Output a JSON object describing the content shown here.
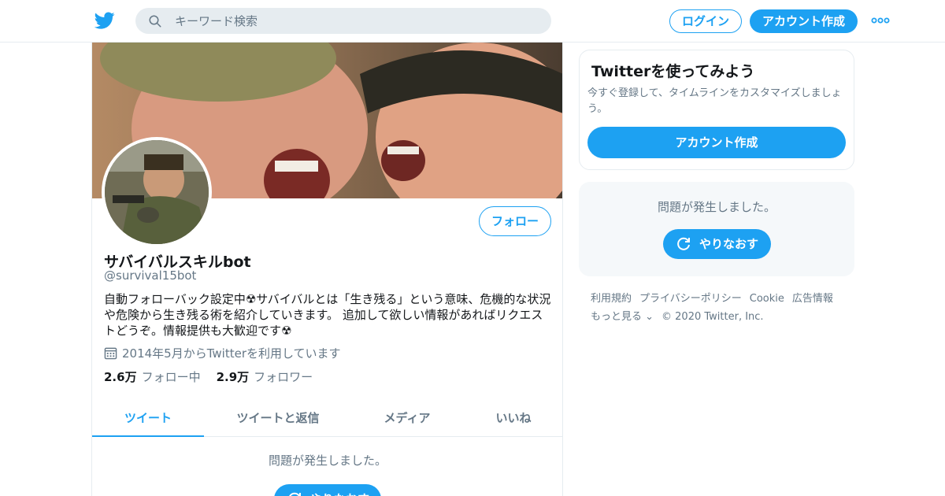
{
  "header": {
    "search_placeholder": "キーワード検索",
    "login_label": "ログイン",
    "signup_label": "アカウント作成"
  },
  "profile": {
    "follow_label": "フォロー",
    "name": "サバイバルスキルbot",
    "handle": "@survival15bot",
    "bio": "自動フォローバック設定中☢サバイバルとは「生き残る」という意味、危機的な状況や危険から生き残る術を紹介していきます。 追加して欲しい情報があればリクエストどうぞ。情報提供も大歓迎です☢",
    "joined": "2014年5月からTwitterを利用しています",
    "following_count": "2.6万",
    "following_label": "フォロー中",
    "followers_count": "2.9万",
    "followers_label": "フォロワー"
  },
  "tabs": [
    {
      "label": "ツイート"
    },
    {
      "label": "ツイートと返信"
    },
    {
      "label": "メディア"
    },
    {
      "label": "いいね"
    }
  ],
  "main_error": {
    "message": "問題が発生しました。",
    "retry_label": "やりなおす"
  },
  "signup_card": {
    "title": "Twitterを使ってみよう",
    "description": "今すぐ登録して、タイムラインをカスタマイズしましょう。",
    "button_label": "アカウント作成"
  },
  "side_error": {
    "message": "問題が発生しました。",
    "retry_label": "やりなおす"
  },
  "footer": {
    "links": [
      "利用規約",
      "プライバシーポリシー",
      "Cookie",
      "広告情報",
      "もっと見る ⌄"
    ],
    "copyright": "© 2020 Twitter, Inc."
  },
  "colors": {
    "accent": "#1da1f2",
    "muted": "#657786",
    "border": "#e6ecf0"
  }
}
